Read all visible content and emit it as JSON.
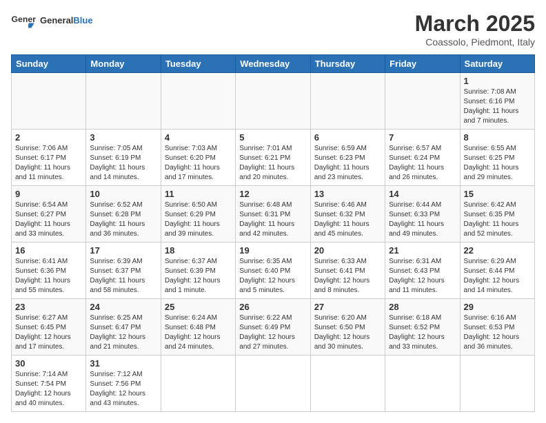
{
  "header": {
    "logo_general": "General",
    "logo_blue": "Blue",
    "month_title": "March 2025",
    "subtitle": "Coassolo, Piedmont, Italy"
  },
  "calendar": {
    "days_of_week": [
      "Sunday",
      "Monday",
      "Tuesday",
      "Wednesday",
      "Thursday",
      "Friday",
      "Saturday"
    ],
    "weeks": [
      [
        {
          "day": "",
          "info": ""
        },
        {
          "day": "",
          "info": ""
        },
        {
          "day": "",
          "info": ""
        },
        {
          "day": "",
          "info": ""
        },
        {
          "day": "",
          "info": ""
        },
        {
          "day": "",
          "info": ""
        },
        {
          "day": "1",
          "info": "Sunrise: 7:08 AM\nSunset: 6:16 PM\nDaylight: 11 hours and 7 minutes."
        }
      ],
      [
        {
          "day": "2",
          "info": "Sunrise: 7:06 AM\nSunset: 6:17 PM\nDaylight: 11 hours and 11 minutes."
        },
        {
          "day": "3",
          "info": "Sunrise: 7:05 AM\nSunset: 6:19 PM\nDaylight: 11 hours and 14 minutes."
        },
        {
          "day": "4",
          "info": "Sunrise: 7:03 AM\nSunset: 6:20 PM\nDaylight: 11 hours and 17 minutes."
        },
        {
          "day": "5",
          "info": "Sunrise: 7:01 AM\nSunset: 6:21 PM\nDaylight: 11 hours and 20 minutes."
        },
        {
          "day": "6",
          "info": "Sunrise: 6:59 AM\nSunset: 6:23 PM\nDaylight: 11 hours and 23 minutes."
        },
        {
          "day": "7",
          "info": "Sunrise: 6:57 AM\nSunset: 6:24 PM\nDaylight: 11 hours and 26 minutes."
        },
        {
          "day": "8",
          "info": "Sunrise: 6:55 AM\nSunset: 6:25 PM\nDaylight: 11 hours and 29 minutes."
        }
      ],
      [
        {
          "day": "9",
          "info": "Sunrise: 6:54 AM\nSunset: 6:27 PM\nDaylight: 11 hours and 33 minutes."
        },
        {
          "day": "10",
          "info": "Sunrise: 6:52 AM\nSunset: 6:28 PM\nDaylight: 11 hours and 36 minutes."
        },
        {
          "day": "11",
          "info": "Sunrise: 6:50 AM\nSunset: 6:29 PM\nDaylight: 11 hours and 39 minutes."
        },
        {
          "day": "12",
          "info": "Sunrise: 6:48 AM\nSunset: 6:31 PM\nDaylight: 11 hours and 42 minutes."
        },
        {
          "day": "13",
          "info": "Sunrise: 6:46 AM\nSunset: 6:32 PM\nDaylight: 11 hours and 45 minutes."
        },
        {
          "day": "14",
          "info": "Sunrise: 6:44 AM\nSunset: 6:33 PM\nDaylight: 11 hours and 49 minutes."
        },
        {
          "day": "15",
          "info": "Sunrise: 6:42 AM\nSunset: 6:35 PM\nDaylight: 11 hours and 52 minutes."
        }
      ],
      [
        {
          "day": "16",
          "info": "Sunrise: 6:41 AM\nSunset: 6:36 PM\nDaylight: 11 hours and 55 minutes."
        },
        {
          "day": "17",
          "info": "Sunrise: 6:39 AM\nSunset: 6:37 PM\nDaylight: 11 hours and 58 minutes."
        },
        {
          "day": "18",
          "info": "Sunrise: 6:37 AM\nSunset: 6:39 PM\nDaylight: 12 hours and 1 minute."
        },
        {
          "day": "19",
          "info": "Sunrise: 6:35 AM\nSunset: 6:40 PM\nDaylight: 12 hours and 5 minutes."
        },
        {
          "day": "20",
          "info": "Sunrise: 6:33 AM\nSunset: 6:41 PM\nDaylight: 12 hours and 8 minutes."
        },
        {
          "day": "21",
          "info": "Sunrise: 6:31 AM\nSunset: 6:43 PM\nDaylight: 12 hours and 11 minutes."
        },
        {
          "day": "22",
          "info": "Sunrise: 6:29 AM\nSunset: 6:44 PM\nDaylight: 12 hours and 14 minutes."
        }
      ],
      [
        {
          "day": "23",
          "info": "Sunrise: 6:27 AM\nSunset: 6:45 PM\nDaylight: 12 hours and 17 minutes."
        },
        {
          "day": "24",
          "info": "Sunrise: 6:25 AM\nSunset: 6:47 PM\nDaylight: 12 hours and 21 minutes."
        },
        {
          "day": "25",
          "info": "Sunrise: 6:24 AM\nSunset: 6:48 PM\nDaylight: 12 hours and 24 minutes."
        },
        {
          "day": "26",
          "info": "Sunrise: 6:22 AM\nSunset: 6:49 PM\nDaylight: 12 hours and 27 minutes."
        },
        {
          "day": "27",
          "info": "Sunrise: 6:20 AM\nSunset: 6:50 PM\nDaylight: 12 hours and 30 minutes."
        },
        {
          "day": "28",
          "info": "Sunrise: 6:18 AM\nSunset: 6:52 PM\nDaylight: 12 hours and 33 minutes."
        },
        {
          "day": "29",
          "info": "Sunrise: 6:16 AM\nSunset: 6:53 PM\nDaylight: 12 hours and 36 minutes."
        }
      ],
      [
        {
          "day": "30",
          "info": "Sunrise: 7:14 AM\nSunset: 7:54 PM\nDaylight: 12 hours and 40 minutes."
        },
        {
          "day": "31",
          "info": "Sunrise: 7:12 AM\nSunset: 7:56 PM\nDaylight: 12 hours and 43 minutes."
        },
        {
          "day": "",
          "info": ""
        },
        {
          "day": "",
          "info": ""
        },
        {
          "day": "",
          "info": ""
        },
        {
          "day": "",
          "info": ""
        },
        {
          "day": "",
          "info": ""
        }
      ]
    ]
  }
}
